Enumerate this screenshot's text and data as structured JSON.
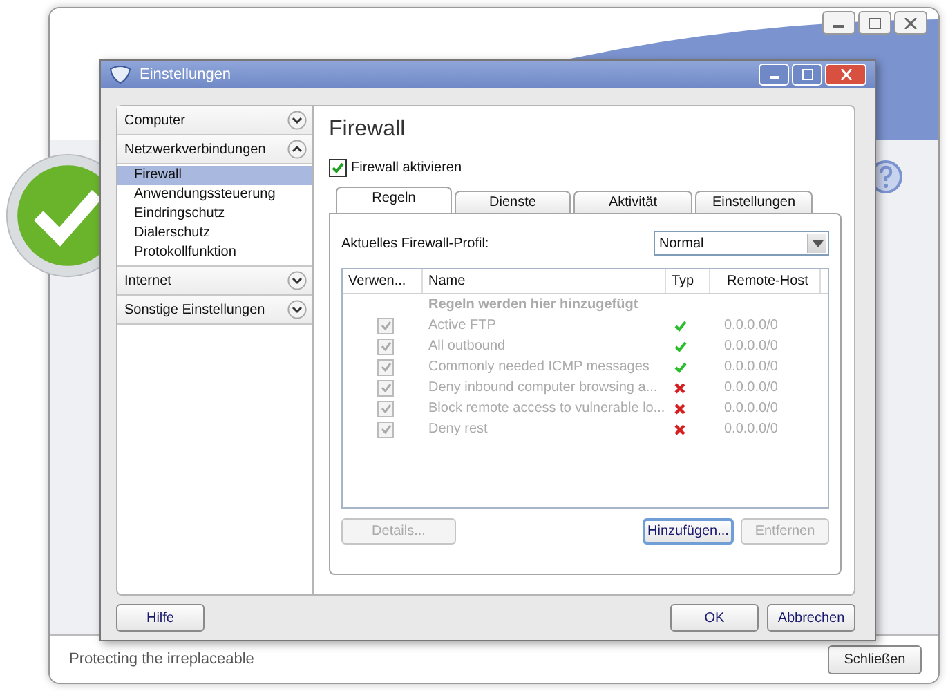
{
  "app": {
    "tagline": "Protecting the irreplaceable",
    "close_button": "Schließen"
  },
  "dialog": {
    "title": "Einstellungen",
    "sidebar": [
      {
        "label": "Computer",
        "expanded": false
      },
      {
        "label": "Netzwerkverbindungen",
        "expanded": true,
        "items": [
          {
            "label": "Firewall",
            "selected": true
          },
          {
            "label": "Anwendungssteuerung",
            "selected": false
          },
          {
            "label": "Eindringschutz",
            "selected": false
          },
          {
            "label": "Dialerschutz",
            "selected": false
          },
          {
            "label": "Protokollfunktion",
            "selected": false
          }
        ]
      },
      {
        "label": "Internet",
        "expanded": false
      },
      {
        "label": "Sonstige Einstellungen",
        "expanded": false
      }
    ],
    "heading": "Firewall",
    "enable_checkbox": {
      "label": "Firewall aktivieren",
      "checked": true
    },
    "tabs": [
      {
        "label": "Regeln",
        "selected": true
      },
      {
        "label": "Dienste",
        "selected": false
      },
      {
        "label": "Aktivität",
        "selected": false
      },
      {
        "label": "Einstellungen",
        "selected": false
      }
    ],
    "profile": {
      "label": "Aktuelles Firewall-Profil:",
      "value": "Normal"
    },
    "table": {
      "columns": [
        "Verwen...",
        "Name",
        "Typ",
        "Remote-Host"
      ],
      "placeholder": "Regeln werden hier hinzugefügt",
      "rows": [
        {
          "checked": true,
          "disabled": true,
          "name": "Active FTP",
          "kind": "allow",
          "host": "0.0.0.0/0"
        },
        {
          "checked": true,
          "disabled": true,
          "name": "All outbound",
          "kind": "allow",
          "host": "0.0.0.0/0"
        },
        {
          "checked": true,
          "disabled": true,
          "name": "Commonly needed ICMP messages",
          "kind": "allow",
          "host": "0.0.0.0/0"
        },
        {
          "checked": true,
          "disabled": true,
          "name": "Deny inbound computer browsing a...",
          "kind": "block",
          "host": "0.0.0.0/0"
        },
        {
          "checked": true,
          "disabled": true,
          "name": "Block remote access to vulnerable lo...",
          "kind": "block",
          "host": "0.0.0.0/0"
        },
        {
          "checked": true,
          "disabled": true,
          "name": "Deny rest",
          "kind": "block",
          "host": "0.0.0.0/0"
        }
      ]
    },
    "table_buttons": [
      {
        "label": "Details...",
        "disabled": true,
        "focused": false
      },
      {
        "label": "Hinzufügen...",
        "disabled": false,
        "focused": true
      },
      {
        "label": "Entfernen",
        "disabled": true,
        "focused": false
      }
    ],
    "help_button": "Hilfe",
    "buttons": [
      "OK",
      "Abbrechen"
    ]
  }
}
